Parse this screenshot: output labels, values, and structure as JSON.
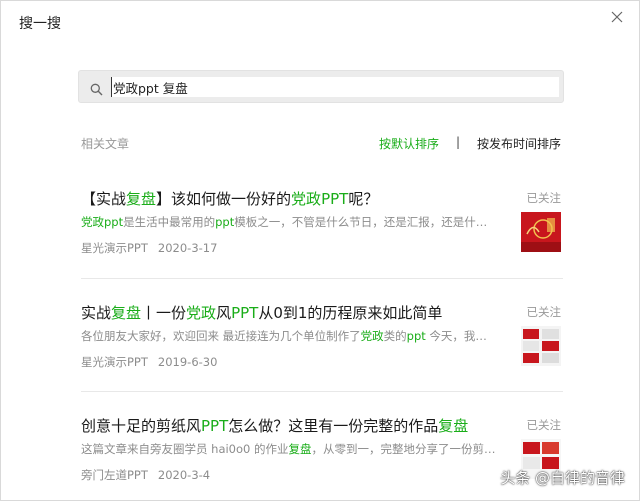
{
  "window": {
    "title": "搜一搜"
  },
  "search": {
    "value": "党政ppt 复盘"
  },
  "section": {
    "label": "相关文章",
    "sort_default": "按默认排序",
    "divider": "|",
    "sort_time": "按发布时间排序"
  },
  "articles": [
    {
      "title_parts": [
        "【实战",
        "复盘",
        "】该如何做一份好的",
        "党政",
        "PPT",
        "呢？"
      ],
      "snippet_parts": [
        "党政",
        "ppt",
        "是生活中最常用的",
        "ppt",
        "模板之一，不管是什么节日，还是汇报，还是什…"
      ],
      "source": "星光演示PPT",
      "date": "2020-3-17",
      "follow": "已关注"
    },
    {
      "title_parts": [
        "实战",
        "复盘",
        "丨一份",
        "党政",
        "风",
        "PPT",
        "从0到1的历程原来如此简单"
      ],
      "snippet_parts": [
        "各位朋友大家好，欢迎回来 最近接连为几个单位制作了",
        "党政",
        "类的",
        "ppt",
        " 今天，我…"
      ],
      "source": "星光演示PPT",
      "date": "2019-6-30",
      "follow": "已关注"
    },
    {
      "title_parts": [
        "创意十足的剪纸风",
        "PPT",
        "怎么做？这里有一份完整的作品",
        "复盘"
      ],
      "snippet_parts": [
        "这篇文章来自旁友圈学员 hai0o0 的作业",
        "复盘",
        "，从零到一，完整地分享了一份剪…"
      ],
      "source": "旁门左道PPT",
      "date": "2020-3-4",
      "follow": "已关注"
    }
  ],
  "watermark": "头条 @自律的音律",
  "colors": {
    "highlight": "#1aad19",
    "muted": "#8c8c8c",
    "thumb_red": "#c8161d"
  }
}
